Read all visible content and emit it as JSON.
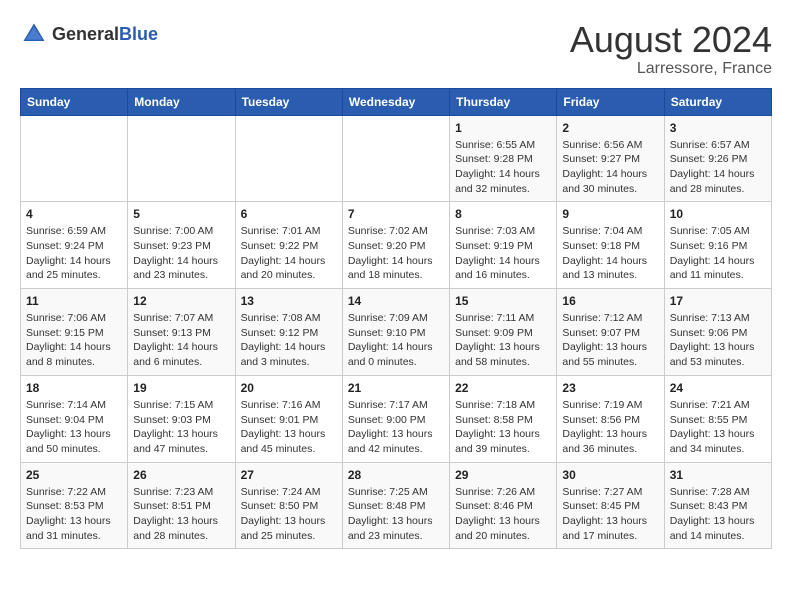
{
  "logo": {
    "text_general": "General",
    "text_blue": "Blue"
  },
  "title": "August 2024",
  "subtitle": "Larressore, France",
  "days_of_week": [
    "Sunday",
    "Monday",
    "Tuesday",
    "Wednesday",
    "Thursday",
    "Friday",
    "Saturday"
  ],
  "weeks": [
    [
      {
        "day": "",
        "info": ""
      },
      {
        "day": "",
        "info": ""
      },
      {
        "day": "",
        "info": ""
      },
      {
        "day": "",
        "info": ""
      },
      {
        "day": "1",
        "info": "Sunrise: 6:55 AM\nSunset: 9:28 PM\nDaylight: 14 hours\nand 32 minutes."
      },
      {
        "day": "2",
        "info": "Sunrise: 6:56 AM\nSunset: 9:27 PM\nDaylight: 14 hours\nand 30 minutes."
      },
      {
        "day": "3",
        "info": "Sunrise: 6:57 AM\nSunset: 9:26 PM\nDaylight: 14 hours\nand 28 minutes."
      }
    ],
    [
      {
        "day": "4",
        "info": "Sunrise: 6:59 AM\nSunset: 9:24 PM\nDaylight: 14 hours\nand 25 minutes."
      },
      {
        "day": "5",
        "info": "Sunrise: 7:00 AM\nSunset: 9:23 PM\nDaylight: 14 hours\nand 23 minutes."
      },
      {
        "day": "6",
        "info": "Sunrise: 7:01 AM\nSunset: 9:22 PM\nDaylight: 14 hours\nand 20 minutes."
      },
      {
        "day": "7",
        "info": "Sunrise: 7:02 AM\nSunset: 9:20 PM\nDaylight: 14 hours\nand 18 minutes."
      },
      {
        "day": "8",
        "info": "Sunrise: 7:03 AM\nSunset: 9:19 PM\nDaylight: 14 hours\nand 16 minutes."
      },
      {
        "day": "9",
        "info": "Sunrise: 7:04 AM\nSunset: 9:18 PM\nDaylight: 14 hours\nand 13 minutes."
      },
      {
        "day": "10",
        "info": "Sunrise: 7:05 AM\nSunset: 9:16 PM\nDaylight: 14 hours\nand 11 minutes."
      }
    ],
    [
      {
        "day": "11",
        "info": "Sunrise: 7:06 AM\nSunset: 9:15 PM\nDaylight: 14 hours\nand 8 minutes."
      },
      {
        "day": "12",
        "info": "Sunrise: 7:07 AM\nSunset: 9:13 PM\nDaylight: 14 hours\nand 6 minutes."
      },
      {
        "day": "13",
        "info": "Sunrise: 7:08 AM\nSunset: 9:12 PM\nDaylight: 14 hours\nand 3 minutes."
      },
      {
        "day": "14",
        "info": "Sunrise: 7:09 AM\nSunset: 9:10 PM\nDaylight: 14 hours\nand 0 minutes."
      },
      {
        "day": "15",
        "info": "Sunrise: 7:11 AM\nSunset: 9:09 PM\nDaylight: 13 hours\nand 58 minutes."
      },
      {
        "day": "16",
        "info": "Sunrise: 7:12 AM\nSunset: 9:07 PM\nDaylight: 13 hours\nand 55 minutes."
      },
      {
        "day": "17",
        "info": "Sunrise: 7:13 AM\nSunset: 9:06 PM\nDaylight: 13 hours\nand 53 minutes."
      }
    ],
    [
      {
        "day": "18",
        "info": "Sunrise: 7:14 AM\nSunset: 9:04 PM\nDaylight: 13 hours\nand 50 minutes."
      },
      {
        "day": "19",
        "info": "Sunrise: 7:15 AM\nSunset: 9:03 PM\nDaylight: 13 hours\nand 47 minutes."
      },
      {
        "day": "20",
        "info": "Sunrise: 7:16 AM\nSunset: 9:01 PM\nDaylight: 13 hours\nand 45 minutes."
      },
      {
        "day": "21",
        "info": "Sunrise: 7:17 AM\nSunset: 9:00 PM\nDaylight: 13 hours\nand 42 minutes."
      },
      {
        "day": "22",
        "info": "Sunrise: 7:18 AM\nSunset: 8:58 PM\nDaylight: 13 hours\nand 39 minutes."
      },
      {
        "day": "23",
        "info": "Sunrise: 7:19 AM\nSunset: 8:56 PM\nDaylight: 13 hours\nand 36 minutes."
      },
      {
        "day": "24",
        "info": "Sunrise: 7:21 AM\nSunset: 8:55 PM\nDaylight: 13 hours\nand 34 minutes."
      }
    ],
    [
      {
        "day": "25",
        "info": "Sunrise: 7:22 AM\nSunset: 8:53 PM\nDaylight: 13 hours\nand 31 minutes."
      },
      {
        "day": "26",
        "info": "Sunrise: 7:23 AM\nSunset: 8:51 PM\nDaylight: 13 hours\nand 28 minutes."
      },
      {
        "day": "27",
        "info": "Sunrise: 7:24 AM\nSunset: 8:50 PM\nDaylight: 13 hours\nand 25 minutes."
      },
      {
        "day": "28",
        "info": "Sunrise: 7:25 AM\nSunset: 8:48 PM\nDaylight: 13 hours\nand 23 minutes."
      },
      {
        "day": "29",
        "info": "Sunrise: 7:26 AM\nSunset: 8:46 PM\nDaylight: 13 hours\nand 20 minutes."
      },
      {
        "day": "30",
        "info": "Sunrise: 7:27 AM\nSunset: 8:45 PM\nDaylight: 13 hours\nand 17 minutes."
      },
      {
        "day": "31",
        "info": "Sunrise: 7:28 AM\nSunset: 8:43 PM\nDaylight: 13 hours\nand 14 minutes."
      }
    ]
  ]
}
